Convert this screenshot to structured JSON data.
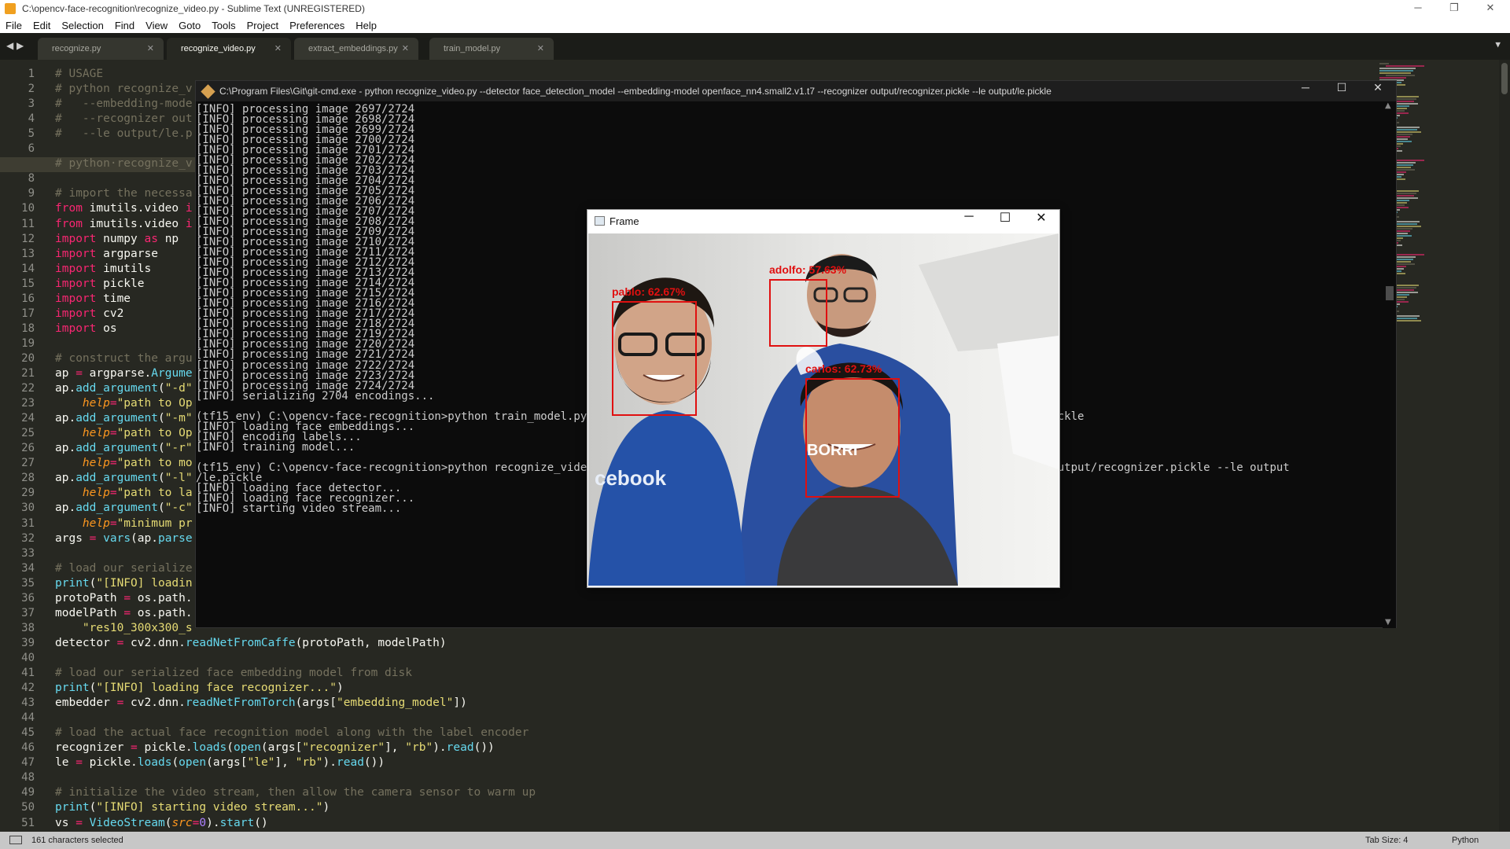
{
  "window": {
    "title": "C:\\opencv-face-recognition\\recognize_video.py - Sublime Text (UNREGISTERED)",
    "minimize": "─",
    "maximize": "❐",
    "close": "✕"
  },
  "menu": [
    "File",
    "Edit",
    "Selection",
    "Find",
    "View",
    "Goto",
    "Tools",
    "Project",
    "Preferences",
    "Help"
  ],
  "tabs": [
    {
      "label": "recognize.py",
      "close": "✕"
    },
    {
      "label": "recognize_video.py",
      "close": "✕"
    },
    {
      "label": "extract_embeddings.py",
      "close": "✕"
    },
    {
      "label": "train_model.py",
      "close": "✕"
    }
  ],
  "tab_nav": "◀ ▶",
  "tab_dropdown": "▼",
  "editor": {
    "current_line": 7,
    "lines": [
      {
        "n": "1",
        "segs": [
          {
            "c": "cm",
            "t": "# USAGE"
          }
        ]
      },
      {
        "n": "2",
        "segs": [
          {
            "c": "cm",
            "t": "# python recognize_v"
          }
        ]
      },
      {
        "n": "3",
        "segs": [
          {
            "c": "cm",
            "t": "#   --embedding-mode"
          }
        ]
      },
      {
        "n": "4",
        "segs": [
          {
            "c": "cm",
            "t": "#   --recognizer out"
          }
        ]
      },
      {
        "n": "5",
        "segs": [
          {
            "c": "cm",
            "t": "#   --le output/le.p"
          }
        ]
      },
      {
        "n": "6",
        "segs": []
      },
      {
        "n": "7",
        "segs": [
          {
            "c": "cm",
            "t": "# python·recognize_v"
          }
        ]
      },
      {
        "n": "8",
        "segs": []
      },
      {
        "n": "9",
        "segs": [
          {
            "c": "cm",
            "t": "# import the necessa"
          }
        ]
      },
      {
        "n": "10",
        "segs": [
          {
            "c": "kw",
            "t": "from"
          },
          {
            "c": "",
            "t": " imutils.video "
          },
          {
            "c": "kw",
            "t": "i"
          }
        ]
      },
      {
        "n": "11",
        "segs": [
          {
            "c": "kw",
            "t": "from"
          },
          {
            "c": "",
            "t": " imutils.video "
          },
          {
            "c": "kw",
            "t": "i"
          }
        ]
      },
      {
        "n": "12",
        "segs": [
          {
            "c": "kw",
            "t": "import"
          },
          {
            "c": "",
            "t": " numpy "
          },
          {
            "c": "kw",
            "t": "as"
          },
          {
            "c": "",
            "t": " np"
          }
        ]
      },
      {
        "n": "13",
        "segs": [
          {
            "c": "kw",
            "t": "import"
          },
          {
            "c": "",
            "t": " argparse"
          }
        ]
      },
      {
        "n": "14",
        "segs": [
          {
            "c": "kw",
            "t": "import"
          },
          {
            "c": "",
            "t": " imutils"
          }
        ]
      },
      {
        "n": "15",
        "segs": [
          {
            "c": "kw",
            "t": "import"
          },
          {
            "c": "",
            "t": " pickle"
          }
        ]
      },
      {
        "n": "16",
        "segs": [
          {
            "c": "kw",
            "t": "import"
          },
          {
            "c": "",
            "t": " time"
          }
        ]
      },
      {
        "n": "17",
        "segs": [
          {
            "c": "kw",
            "t": "import"
          },
          {
            "c": "",
            "t": " cv2"
          }
        ]
      },
      {
        "n": "18",
        "segs": [
          {
            "c": "kw",
            "t": "import"
          },
          {
            "c": "",
            "t": " os"
          }
        ]
      },
      {
        "n": "19",
        "segs": []
      },
      {
        "n": "20",
        "segs": [
          {
            "c": "cm",
            "t": "# construct the argu"
          }
        ]
      },
      {
        "n": "21",
        "segs": [
          {
            "c": "",
            "t": "ap "
          },
          {
            "c": "kw",
            "t": "="
          },
          {
            "c": "",
            "t": " argparse."
          },
          {
            "c": "fn",
            "t": "Argume"
          }
        ]
      },
      {
        "n": "22",
        "segs": [
          {
            "c": "",
            "t": "ap."
          },
          {
            "c": "fn",
            "t": "add_argument"
          },
          {
            "c": "",
            "t": "("
          },
          {
            "c": "st",
            "t": "\"-d\""
          }
        ]
      },
      {
        "n": "23",
        "segs": [
          {
            "c": "",
            "t": "    "
          },
          {
            "c": "ar",
            "t": "help"
          },
          {
            "c": "kw",
            "t": "="
          },
          {
            "c": "st",
            "t": "\"path to Op"
          }
        ]
      },
      {
        "n": "24",
        "segs": [
          {
            "c": "",
            "t": "ap."
          },
          {
            "c": "fn",
            "t": "add_argument"
          },
          {
            "c": "",
            "t": "("
          },
          {
            "c": "st",
            "t": "\"-m\""
          }
        ]
      },
      {
        "n": "25",
        "segs": [
          {
            "c": "",
            "t": "    "
          },
          {
            "c": "ar",
            "t": "help"
          },
          {
            "c": "kw",
            "t": "="
          },
          {
            "c": "st",
            "t": "\"path to Op"
          }
        ]
      },
      {
        "n": "26",
        "segs": [
          {
            "c": "",
            "t": "ap."
          },
          {
            "c": "fn",
            "t": "add_argument"
          },
          {
            "c": "",
            "t": "("
          },
          {
            "c": "st",
            "t": "\"-r\""
          }
        ]
      },
      {
        "n": "27",
        "segs": [
          {
            "c": "",
            "t": "    "
          },
          {
            "c": "ar",
            "t": "help"
          },
          {
            "c": "kw",
            "t": "="
          },
          {
            "c": "st",
            "t": "\"path to mo"
          }
        ]
      },
      {
        "n": "28",
        "segs": [
          {
            "c": "",
            "t": "ap."
          },
          {
            "c": "fn",
            "t": "add_argument"
          },
          {
            "c": "",
            "t": "("
          },
          {
            "c": "st",
            "t": "\"-l\""
          }
        ]
      },
      {
        "n": "29",
        "segs": [
          {
            "c": "",
            "t": "    "
          },
          {
            "c": "ar",
            "t": "help"
          },
          {
            "c": "kw",
            "t": "="
          },
          {
            "c": "st",
            "t": "\"path to la"
          }
        ]
      },
      {
        "n": "30",
        "segs": [
          {
            "c": "",
            "t": "ap."
          },
          {
            "c": "fn",
            "t": "add_argument"
          },
          {
            "c": "",
            "t": "("
          },
          {
            "c": "st",
            "t": "\"-c\""
          }
        ]
      },
      {
        "n": "31",
        "segs": [
          {
            "c": "",
            "t": "    "
          },
          {
            "c": "ar",
            "t": "help"
          },
          {
            "c": "kw",
            "t": "="
          },
          {
            "c": "st",
            "t": "\"minimum pr"
          }
        ]
      },
      {
        "n": "32",
        "segs": [
          {
            "c": "",
            "t": "args "
          },
          {
            "c": "kw",
            "t": "="
          },
          {
            "c": "",
            "t": " "
          },
          {
            "c": "fn",
            "t": "vars"
          },
          {
            "c": "",
            "t": "(ap."
          },
          {
            "c": "fn",
            "t": "parse"
          }
        ]
      },
      {
        "n": "33",
        "segs": []
      },
      {
        "n": "34",
        "segs": [
          {
            "c": "cm",
            "t": "# load our serialize"
          }
        ]
      },
      {
        "n": "35",
        "segs": [
          {
            "c": "fn",
            "t": "print"
          },
          {
            "c": "",
            "t": "("
          },
          {
            "c": "st",
            "t": "\"[INFO] loadin"
          }
        ]
      },
      {
        "n": "36",
        "segs": [
          {
            "c": "",
            "t": "protoPath "
          },
          {
            "c": "kw",
            "t": "="
          },
          {
            "c": "",
            "t": " os.path."
          }
        ]
      },
      {
        "n": "37",
        "segs": [
          {
            "c": "",
            "t": "modelPath "
          },
          {
            "c": "kw",
            "t": "="
          },
          {
            "c": "",
            "t": " os.path."
          }
        ]
      },
      {
        "n": "38",
        "segs": [
          {
            "c": "",
            "t": "    "
          },
          {
            "c": "st",
            "t": "\"res10_300x300_s"
          }
        ]
      },
      {
        "n": "39",
        "segs": [
          {
            "c": "",
            "t": "detector "
          },
          {
            "c": "kw",
            "t": "="
          },
          {
            "c": "",
            "t": " cv2.dnn."
          },
          {
            "c": "fn",
            "t": "readNetFromCaffe"
          },
          {
            "c": "",
            "t": "(protoPath, modelPath)"
          }
        ]
      },
      {
        "n": "40",
        "segs": []
      },
      {
        "n": "41",
        "segs": [
          {
            "c": "cm",
            "t": "# load our serialized face embedding model from disk"
          }
        ]
      },
      {
        "n": "42",
        "segs": [
          {
            "c": "fn",
            "t": "print"
          },
          {
            "c": "",
            "t": "("
          },
          {
            "c": "st",
            "t": "\"[INFO] loading face recognizer...\""
          },
          {
            "c": "",
            "t": ")"
          }
        ]
      },
      {
        "n": "43",
        "segs": [
          {
            "c": "",
            "t": "embedder "
          },
          {
            "c": "kw",
            "t": "="
          },
          {
            "c": "",
            "t": " cv2.dnn."
          },
          {
            "c": "fn",
            "t": "readNetFromTorch"
          },
          {
            "c": "",
            "t": "(args["
          },
          {
            "c": "st",
            "t": "\"embedding_model\""
          },
          {
            "c": "",
            "t": "])"
          }
        ]
      },
      {
        "n": "44",
        "segs": []
      },
      {
        "n": "45",
        "segs": [
          {
            "c": "cm",
            "t": "# load the actual face recognition model along with the label encoder"
          }
        ]
      },
      {
        "n": "46",
        "segs": [
          {
            "c": "",
            "t": "recognizer "
          },
          {
            "c": "kw",
            "t": "="
          },
          {
            "c": "",
            "t": " pickle."
          },
          {
            "c": "fn",
            "t": "loads"
          },
          {
            "c": "",
            "t": "("
          },
          {
            "c": "fn",
            "t": "open"
          },
          {
            "c": "",
            "t": "(args["
          },
          {
            "c": "st",
            "t": "\"recognizer\""
          },
          {
            "c": "",
            "t": "], "
          },
          {
            "c": "st",
            "t": "\"rb\""
          },
          {
            "c": "",
            "t": ")."
          },
          {
            "c": "fn",
            "t": "read"
          },
          {
            "c": "",
            "t": "())"
          }
        ]
      },
      {
        "n": "47",
        "segs": [
          {
            "c": "",
            "t": "le "
          },
          {
            "c": "kw",
            "t": "="
          },
          {
            "c": "",
            "t": " pickle."
          },
          {
            "c": "fn",
            "t": "loads"
          },
          {
            "c": "",
            "t": "("
          },
          {
            "c": "fn",
            "t": "open"
          },
          {
            "c": "",
            "t": "(args["
          },
          {
            "c": "st",
            "t": "\"le\""
          },
          {
            "c": "",
            "t": "], "
          },
          {
            "c": "st",
            "t": "\"rb\""
          },
          {
            "c": "",
            "t": ")."
          },
          {
            "c": "fn",
            "t": "read"
          },
          {
            "c": "",
            "t": "())"
          }
        ]
      },
      {
        "n": "48",
        "segs": []
      },
      {
        "n": "49",
        "segs": [
          {
            "c": "cm",
            "t": "# initialize the video stream, then allow the camera sensor to warm up"
          }
        ]
      },
      {
        "n": "50",
        "segs": [
          {
            "c": "fn",
            "t": "print"
          },
          {
            "c": "",
            "t": "("
          },
          {
            "c": "st",
            "t": "\"[INFO] starting video stream...\""
          },
          {
            "c": "",
            "t": ")"
          }
        ]
      },
      {
        "n": "51",
        "segs": [
          {
            "c": "",
            "t": "vs "
          },
          {
            "c": "kw",
            "t": "="
          },
          {
            "c": "",
            "t": " "
          },
          {
            "c": "fn",
            "t": "VideoStream"
          },
          {
            "c": "",
            "t": "("
          },
          {
            "c": "ar",
            "t": "src"
          },
          {
            "c": "kw",
            "t": "="
          },
          {
            "c": "nu",
            "t": "0"
          },
          {
            "c": "",
            "t": ")."
          },
          {
            "c": "fn",
            "t": "start"
          },
          {
            "c": "",
            "t": "()"
          }
        ]
      },
      {
        "n": "52",
        "segs": [
          {
            "c": "",
            "t": "time."
          },
          {
            "c": "fn",
            "t": "sleep"
          },
          {
            "c": "",
            "t": "("
          },
          {
            "c": "nu",
            "t": "2.0"
          },
          {
            "c": "",
            "t": ")"
          }
        ]
      }
    ]
  },
  "console": {
    "title": "C:\\Program Files\\Git\\git-cmd.exe - python  recognize_video.py --detector face_detection_model --embedding-model openface_nn4.small2.v1.t7 --recognizer output/recognizer.pickle --le output/le.pickle",
    "minimize": "─",
    "maximize": "☐",
    "close": "✕",
    "lines": [
      "[INFO] processing image 2697/2724",
      "[INFO] processing image 2698/2724",
      "[INFO] processing image 2699/2724",
      "[INFO] processing image 2700/2724",
      "[INFO] processing image 2701/2724",
      "[INFO] processing image 2702/2724",
      "[INFO] processing image 2703/2724",
      "[INFO] processing image 2704/2724",
      "[INFO] processing image 2705/2724",
      "[INFO] processing image 2706/2724",
      "[INFO] processing image 2707/2724",
      "[INFO] processing image 2708/2724",
      "[INFO] processing image 2709/2724",
      "[INFO] processing image 2710/2724",
      "[INFO] processing image 2711/2724",
      "[INFO] processing image 2712/2724",
      "[INFO] processing image 2713/2724",
      "[INFO] processing image 2714/2724",
      "[INFO] processing image 2715/2724",
      "[INFO] processing image 2716/2724",
      "[INFO] processing image 2717/2724",
      "[INFO] processing image 2718/2724",
      "[INFO] processing image 2719/2724",
      "[INFO] processing image 2720/2724",
      "[INFO] processing image 2721/2724",
      "[INFO] processing image 2722/2724",
      "[INFO] processing image 2723/2724",
      "[INFO] processing image 2724/2724",
      "[INFO] serializing 2704 encodings...",
      "",
      "(tf15_env) C:\\opencv-face-recognition>python train_model.py --e                                                    le output/le.pickle",
      "[INFO] loading face embeddings...",
      "[INFO] encoding labels...",
      "[INFO] training model...",
      "",
      "(tf15_env) C:\\opencv-face-recognition>python recognize_video.py                                                   7 --recognizer output/recognizer.pickle --le output",
      "/le.pickle",
      "[INFO] loading face detector...",
      "[INFO] loading face recognizer...",
      "[INFO] starting video stream..."
    ]
  },
  "frame": {
    "title": "Frame",
    "minimize": "─",
    "maximize": "☐",
    "close": "✕",
    "faces": [
      {
        "label": "pablo: 62.67%"
      },
      {
        "label": "adolfo: 57.63%"
      },
      {
        "label": "carlos: 62.73%"
      }
    ],
    "shirt_text_1": "BORRI",
    "shirt_text_2": "cebook"
  },
  "status": {
    "selection": "161 characters selected",
    "tab_size": "Tab Size: 4",
    "syntax": "Python"
  }
}
